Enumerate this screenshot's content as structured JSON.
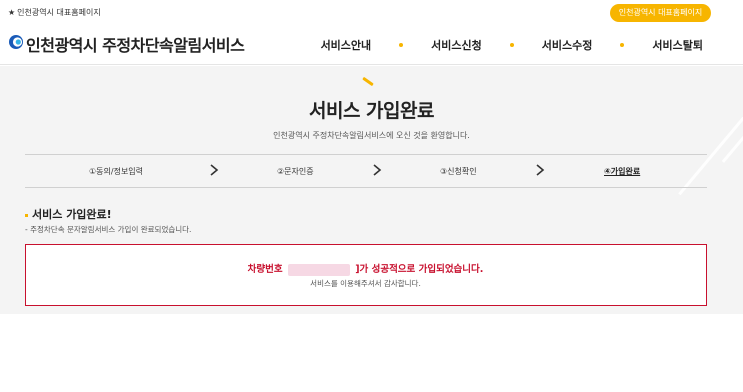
{
  "topbar": {
    "site_link": "인천광역시 대표홈페이지",
    "home_button": "인천광역시 대표홈페이지"
  },
  "header": {
    "logo_text": "인천광역시 주정차단속알림서비스",
    "nav": [
      "서비스안내",
      "서비스신청",
      "서비스수정",
      "서비스탈퇴"
    ]
  },
  "main": {
    "title": "서비스 가입완료",
    "subtitle": "인천광역시 주정차단속알림서비스에 오신 것을 환영합니다.",
    "steps": [
      "①동의/정보입력",
      "②문자인증",
      "③신청확인",
      "④가입완료"
    ],
    "active_step_index": 3,
    "section_title": "서비스 가입완료!",
    "section_desc": "- 주정차단속 문자알림서비스 가입이 완료되었습니다.",
    "result": {
      "prefix": "차량번호",
      "suffix": "]가 성공적으로 가입되었습니다.",
      "message": "서비스를 이용해주셔서 감사합니다."
    }
  },
  "colors": {
    "accent": "#f7b500",
    "alert": "#c8102e",
    "background": "#f4f4f4",
    "logo_blue": "#1a5bb8"
  },
  "icons": [
    "star-icon",
    "logo-icon",
    "chevron-right-icon"
  ]
}
